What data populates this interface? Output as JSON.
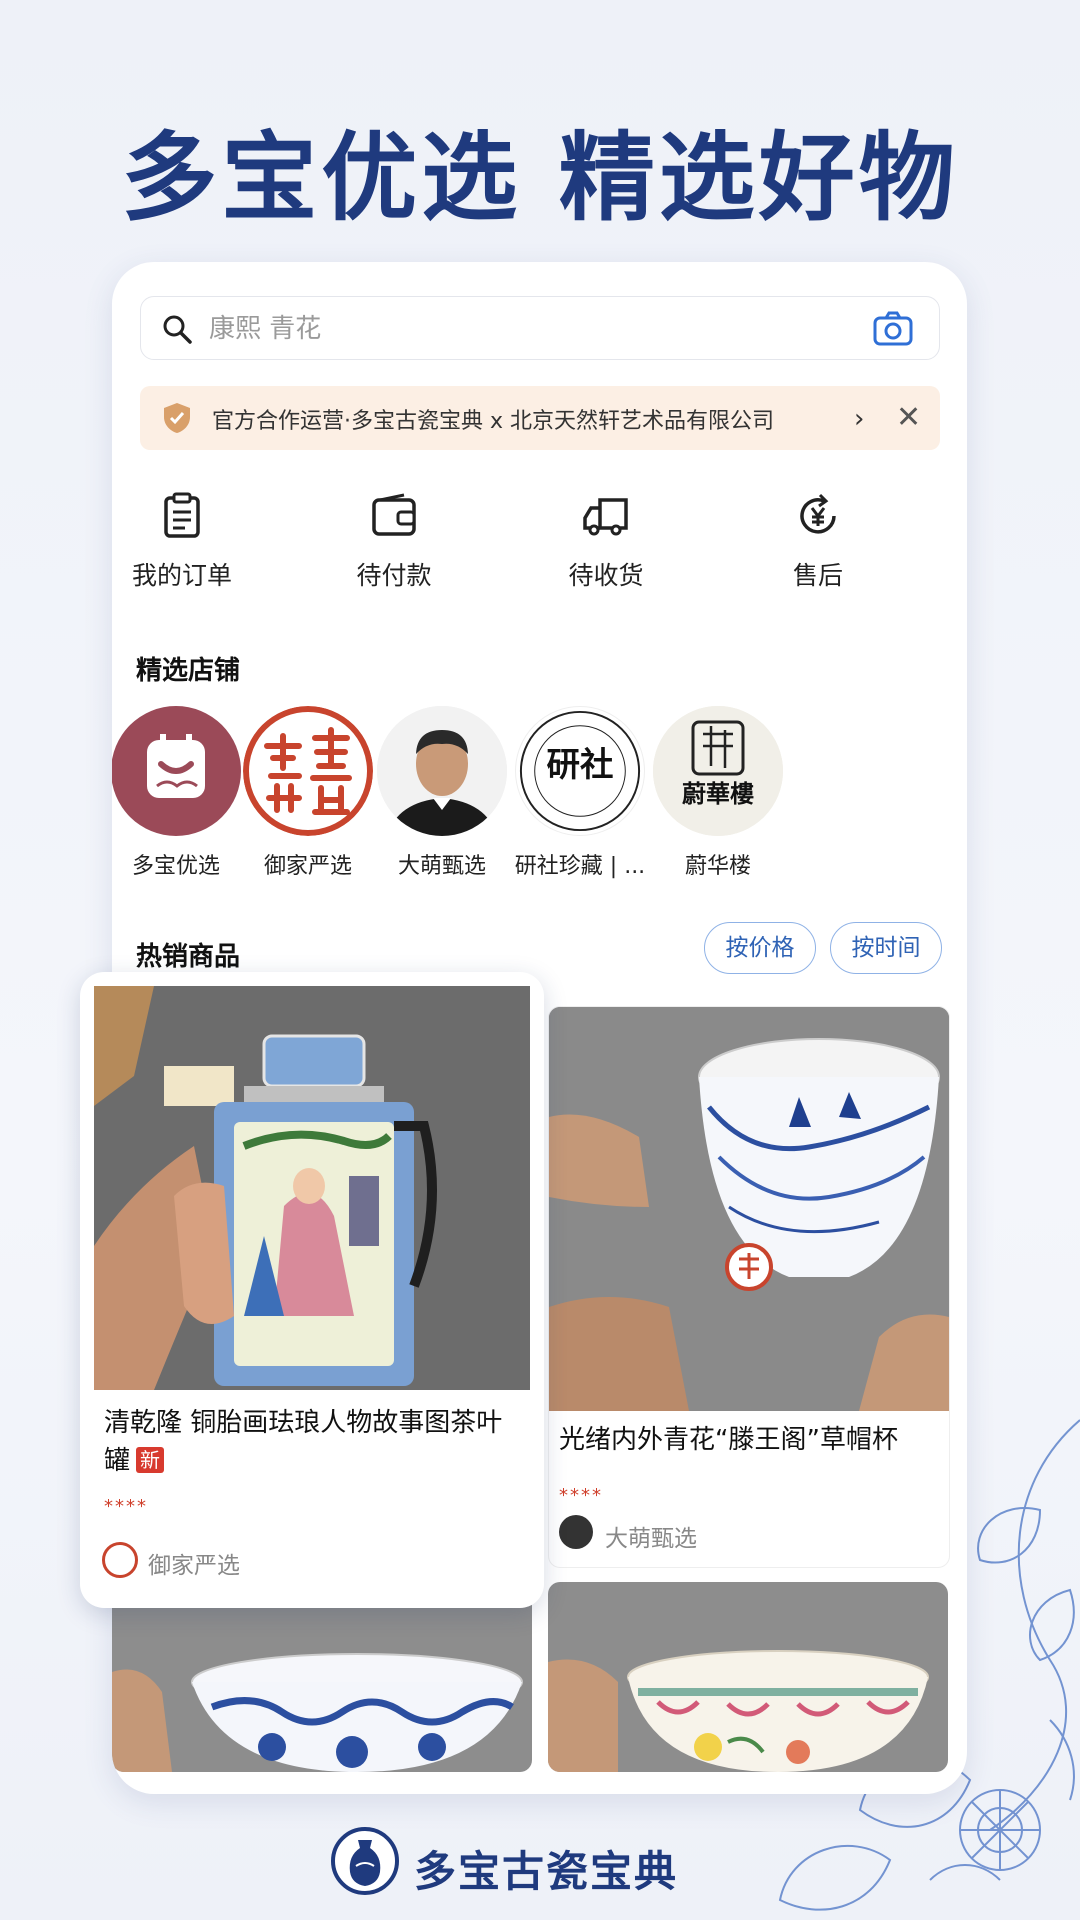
{
  "headline": "多宝优选 精选好物",
  "search": {
    "placeholder": "康熙 青花"
  },
  "notice": {
    "text": "官方合作运营·多宝古瓷宝典 x 北京天然轩艺术品有限公司",
    "chevron": "›",
    "close": "✕"
  },
  "orders": [
    {
      "label": "我的订单",
      "icon": "clipboard-icon"
    },
    {
      "label": "待付款",
      "icon": "wallet-icon"
    },
    {
      "label": "待收货",
      "icon": "truck-icon"
    },
    {
      "label": "售后",
      "icon": "refund-yen-icon"
    }
  ],
  "shops_title": "精选店铺",
  "shops": [
    {
      "name": "多宝优选"
    },
    {
      "name": "御家严选"
    },
    {
      "name": "大萌甄选"
    },
    {
      "name": "研社珍藏 | ..."
    },
    {
      "name": "蔚华楼"
    }
  ],
  "logo_text": {
    "yanshe": "研社",
    "weihualou": "蔚華樓"
  },
  "hot_title": "热销商品",
  "sort": {
    "by_price": "按价格",
    "by_time": "按时间"
  },
  "products": [
    {
      "title": "清乾隆 铜胎画珐琅人物故事图茶叶罐",
      "badge": "新",
      "stars": "****",
      "seller": "御家严选"
    },
    {
      "title": "光绪内外青花“滕王阁”草帽杯",
      "stars": "****",
      "seller": "大萌甄选"
    }
  ],
  "footer": {
    "brand": "多宝古瓷宝典"
  },
  "colors": {
    "brand_blue": "#1f3a7e",
    "accent_blue": "#2f63b5",
    "notice_bg": "#fcefe4",
    "badge_red": "#d83a2e"
  }
}
